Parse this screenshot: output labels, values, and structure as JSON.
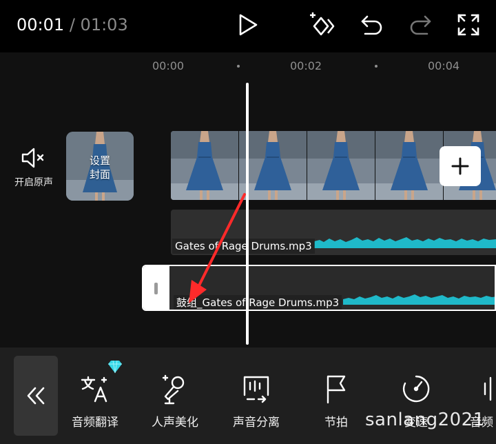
{
  "header": {
    "current_time": "00:01",
    "separator": "/",
    "total_time": "01:03",
    "icons": [
      "play-icon",
      "keyframe-icon",
      "undo-icon",
      "redo-icon",
      "fullscreen-icon"
    ]
  },
  "ruler": {
    "ticks": [
      "00:00",
      "00:02",
      "00:04"
    ]
  },
  "left": {
    "mute_label": "开启原声",
    "cover_label_line1": "设置",
    "cover_label_line2": "封面"
  },
  "tracks": {
    "audio1_name": "Gates of Rage Drums.mp3",
    "audio2_name": "鼓组_Gates of Rage Drums.mp3"
  },
  "toolbar": {
    "items": [
      {
        "label": "音频翻译",
        "icon": "translate-icon",
        "badge": "diamond-icon"
      },
      {
        "label": "人声美化",
        "icon": "microphone-icon"
      },
      {
        "label": "声音分离",
        "icon": "sound-separation-icon"
      },
      {
        "label": "节拍",
        "icon": "flag-icon"
      },
      {
        "label": "变速",
        "icon": "speed-icon"
      },
      {
        "label": "音频",
        "icon": "audio-icon"
      }
    ]
  },
  "watermark": "sanlang2021",
  "colors": {
    "accent_wave": "#1fb9c9",
    "background": "#111111",
    "topbar": "#000000",
    "annotation_arrow": "#ff2a2a"
  }
}
